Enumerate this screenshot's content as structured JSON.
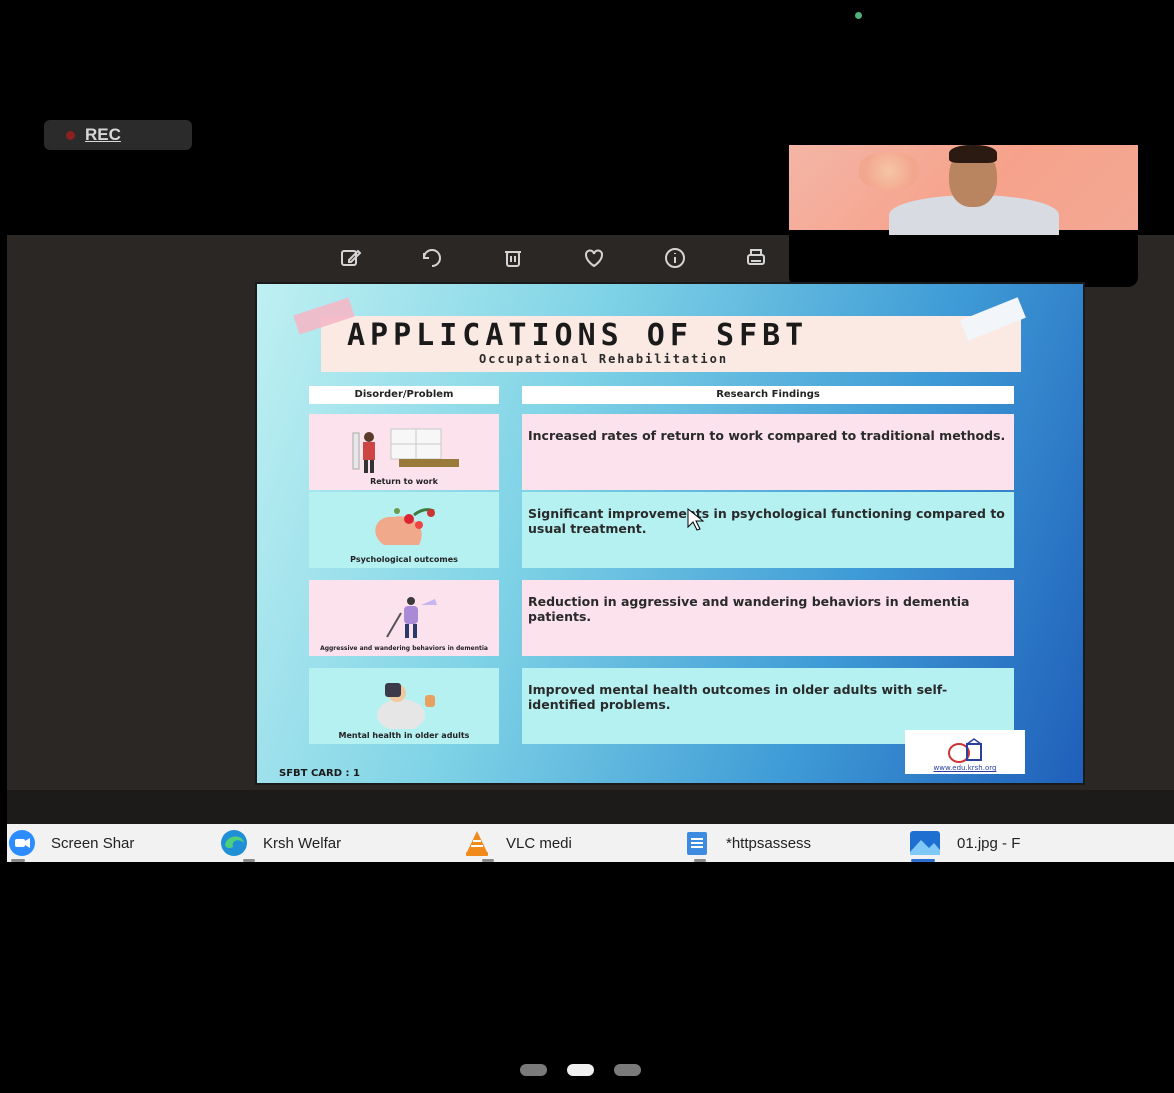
{
  "recording": {
    "label": "REC"
  },
  "viewer_toolbar": {
    "icons": [
      "edit-icon",
      "rotate-icon",
      "delete-icon",
      "favorite-icon",
      "info-icon",
      "print-icon"
    ]
  },
  "slide": {
    "title": "APPLICATIONS OF SFBT",
    "subtitle": "Occupational Rehabilitation",
    "header_left": "Disorder/Problem",
    "header_right": "Research Findings",
    "rows": [
      {
        "problem": "Return to work",
        "finding": "Increased rates of return to work compared to traditional methods."
      },
      {
        "problem": "Psychological outcomes",
        "finding": "Significant improvements in psychological functioning compared to usual treatment."
      },
      {
        "problem": "Aggressive and wandering behaviors in dementia",
        "finding": "Reduction in aggressive and wandering behaviors in dementia patients."
      },
      {
        "problem": "Mental health in older adults",
        "finding": "Improved mental health outcomes in older adults with self-identified problems."
      }
    ],
    "footer": "SFBT CARD : 1",
    "logo_url": "www.edu.krsh.org"
  },
  "taskbar": {
    "items": [
      {
        "label": "Screen Shar",
        "icon": "zoom-icon"
      },
      {
        "label": "Krsh Welfar",
        "icon": "edge-icon"
      },
      {
        "label": "VLC medi",
        "icon": "vlc-icon"
      },
      {
        "label": "*httpsassess",
        "icon": "notepad-icon"
      },
      {
        "label": "01.jpg - F",
        "icon": "photos-icon"
      }
    ]
  },
  "pager": {
    "count": 3,
    "active_index": 1
  }
}
